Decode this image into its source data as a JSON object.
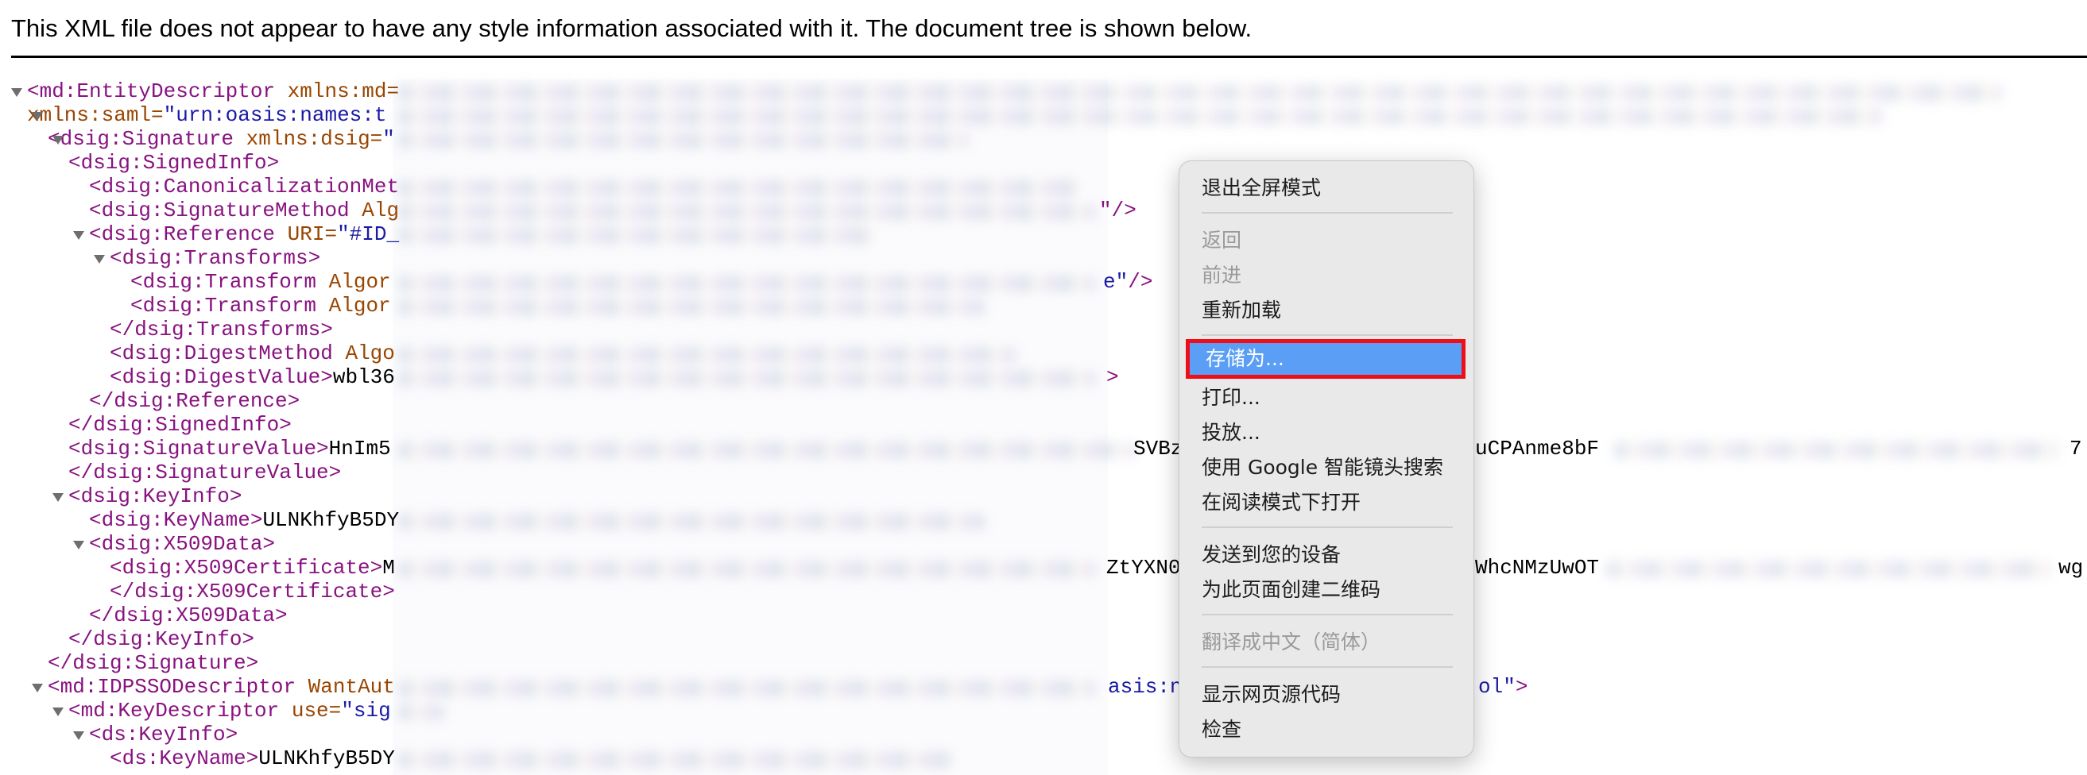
{
  "header": {
    "message": "This XML file does not appear to have any style information associated with it. The document tree is shown below."
  },
  "tree": {
    "l1_tag": "<md:EntityDescriptor",
    "l1_attr": " xmlns:md=",
    "l2_attr": "xmlns:saml=",
    "l2_val": "\"urn:oasis:names:t",
    "l3_tag": "<dsig:Signature",
    "l3_attr": " xmlns:dsig=",
    "l3_val": "\"",
    "l4_tag": "<dsig:SignedInfo>",
    "l5_tag": "<dsig:CanonicalizationMet",
    "l6_tag": "<dsig:SignatureMethod",
    "l6_attr": " Alg",
    "l6_end": "\"/>",
    "l7_tag": "<dsig:Reference",
    "l7_attr": " URI=",
    "l7_val": "\"#ID_",
    "l8_tag": "<dsig:Transforms>",
    "l9_tag": "<dsig:Transform",
    "l9_attr": " Algor",
    "l9_end_val": "e\"",
    "l9_end": "/>",
    "l10_tag": "<dsig:Transform",
    "l10_attr": " Algor",
    "l11_tag": "</dsig:Transforms>",
    "l12_tag": "<dsig:DigestMethod",
    "l12_attr": " Algo",
    "l13_tag": "<dsig:DigestValue>",
    "l13_text": "wbl36",
    "l13_end": ">",
    "l14_tag": "</dsig:Reference>",
    "l15_tag": "</dsig:SignedInfo>",
    "l16_tag": "<dsig:SignatureValue>",
    "l16_text": "HnIm5",
    "l16_mid": "SVBzjgs",
    "l16_mid2": "uCPAnme8bF",
    "l16_end": "7",
    "l17_tag": "</dsig:SignatureValue>",
    "l18_tag": "<dsig:KeyInfo>",
    "l19_tag": "<dsig:KeyName>",
    "l19_text": "ULNKhfyB5DY",
    "l20_tag": "<dsig:X509Data>",
    "l21_tag": "<dsig:X509Certificate>",
    "l21_text": "M",
    "l21_mid": "ZtYXN0",
    "l21_mid2": "WhcNMzUwOT",
    "l21_end": "wg",
    "l22_tag": "</dsig:X509Certificate>",
    "l23_tag": "</dsig:X509Data>",
    "l24_tag": "</dsig:KeyInfo>",
    "l25_tag": "</dsig:Signature>",
    "l26_tag": "<md:IDPSSODescriptor",
    "l26_attr": " WantAut",
    "l26_mid": "asis:n",
    "l26_end_val": "ol\"",
    "l26_end": ">",
    "l27_tag": "<md:KeyDescriptor",
    "l27_attr": " use=",
    "l27_val": "\"sig",
    "l28_tag": "<ds:KeyInfo>",
    "l29_tag": "<ds:KeyName>",
    "l29_text": "ULNKhfyB5DY"
  },
  "context_menu": {
    "exit_fullscreen": "退出全屏模式",
    "back": "返回",
    "forward": "前进",
    "reload": "重新加载",
    "save_as": "存储为...",
    "print": "打印...",
    "cast": "投放...",
    "google_lens": "使用 Google 智能镜头搜索",
    "reader_mode": "在阅读模式下打开",
    "send_to_devices": "发送到您的设备",
    "create_qr": "为此页面创建二维码",
    "translate": "翻译成中文（简体）",
    "view_source": "显示网页源代码",
    "inspect": "检查"
  },
  "colors": {
    "tag": "#881280",
    "attribute": "#994500",
    "attribute_value": "#1a1aa6",
    "menu_background": "#e9e9e9",
    "menu_highlight": "#5a9ff5",
    "annotation_box": "#ef0e18"
  }
}
